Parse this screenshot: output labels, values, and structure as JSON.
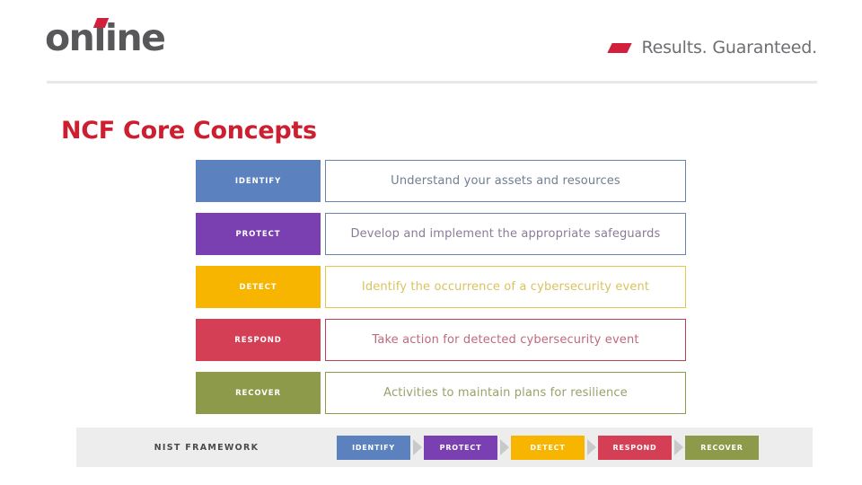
{
  "header": {
    "logo_text": "online",
    "logo_accent_icon": "red-slash-accent-icon",
    "tagline_mark_icon": "red-parallelogram-icon",
    "tagline_text": "Results. Guaranteed."
  },
  "page_title": "NCF Core Concepts",
  "concepts": {
    "rows": [
      {
        "label": "IDENTIFY",
        "description": "Understand your assets and resources",
        "fill_color": "#5b82be",
        "border_color": "#6b85a8",
        "text_color": "#6f7e92"
      },
      {
        "label": "PROTECT",
        "description": "Develop and implement the appropriate safeguards",
        "fill_color": "#7a3fb0",
        "border_color": "#6b85a8",
        "text_color": "#8a7c99"
      },
      {
        "label": "DETECT",
        "description": "Identify the occurrence of a cybersecurity event",
        "fill_color": "#f7b500",
        "border_color": "#e3c94a",
        "text_color": "#d9c35f"
      },
      {
        "label": "RESPOND",
        "description": "Take action for detected cybersecurity event",
        "fill_color": "#d43f56",
        "border_color": "#bc4055",
        "text_color": "#bf6a7c"
      },
      {
        "label": "RECOVER",
        "description": "Activities to maintain plans for resilience",
        "fill_color": "#8c9a4a",
        "border_color": "#8c9a4a",
        "text_color": "#9aa169"
      }
    ]
  },
  "navbar": {
    "title": "NIST FRAMEWORK",
    "background_color": "#ededee",
    "arrow_color": "#c9c9c9",
    "steps": [
      {
        "label": "IDENTIFY",
        "color": "#5b82be"
      },
      {
        "label": "PROTECT",
        "color": "#7a3fb0"
      },
      {
        "label": "DETECT",
        "color": "#f7b500"
      },
      {
        "label": "RESPOND",
        "color": "#d43f56"
      },
      {
        "label": "RECOVER",
        "color": "#8c9a4a"
      }
    ]
  }
}
